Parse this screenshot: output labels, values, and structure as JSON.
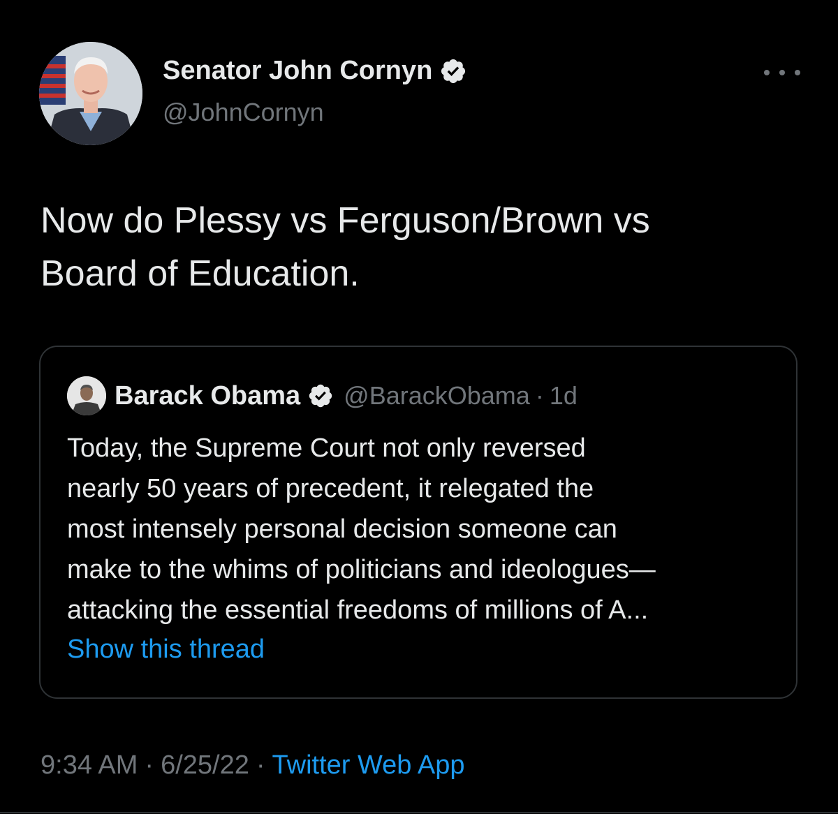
{
  "colors": {
    "background": "#000000",
    "primary_text": "#e7e9ea",
    "secondary_text": "#71767b",
    "link": "#1d9bf0",
    "border": "#2f3336",
    "verified_badge": "#e7e9ea"
  },
  "tweet": {
    "author": {
      "name": "Senator John Cornyn",
      "handle": "@JohnCornyn",
      "verified": true,
      "avatar_icon": "profile-photo"
    },
    "more_icon": "more-horizontal-icon",
    "text_lines": [
      "Now do Plessy vs Ferguson/Brown vs",
      "Board of Education."
    ],
    "quoted": {
      "name": "Barack Obama",
      "handle": "@BarackObama",
      "separator": "·",
      "time": "1d",
      "verified": true,
      "text_lines": [
        "Today, the Supreme Court not only reversed",
        "nearly 50 years of precedent, it relegated the",
        "most intensely personal decision someone can",
        "make to the whims of politicians and ideologues—",
        "attacking the essential freedoms of millions of A..."
      ],
      "show_thread_label": "Show this thread"
    },
    "meta": {
      "time": "9:34 AM",
      "separator": "·",
      "date": "6/25/22",
      "source": "Twitter Web App"
    }
  }
}
